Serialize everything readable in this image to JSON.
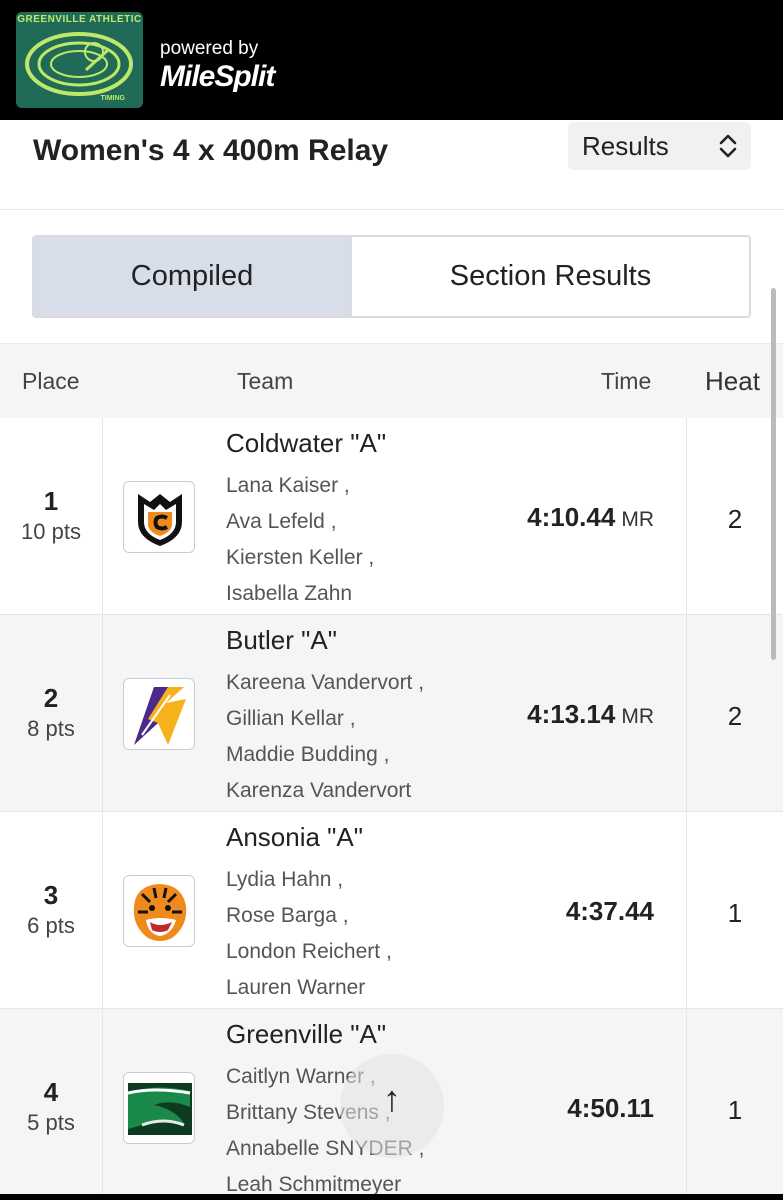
{
  "brand": {
    "logo_text": "GREENVILLE ATHLETIC",
    "logo_sub": "TIMING",
    "powered_by": "powered by",
    "wordmark": "MileSplit"
  },
  "header": {
    "event_title": "Women's 4 x 400m Relay",
    "view_select": "Results"
  },
  "tabs": {
    "compiled": "Compiled",
    "section_results": "Section Results"
  },
  "table": {
    "columns": {
      "place": "Place",
      "team": "Team",
      "time": "Time",
      "heat": "Heat"
    },
    "rows": [
      {
        "place": "1",
        "points": "10 pts",
        "team": "Coldwater \"A\"",
        "athletes": [
          "Lana Kaiser ,",
          "Ava Lefeld ,",
          "Kiersten Keller ,",
          "Isabella Zahn"
        ],
        "time": "4:10.44",
        "mark": "MR",
        "heat": "2",
        "logo": "coldwater-shield-icon"
      },
      {
        "place": "2",
        "points": "8 pts",
        "team": "Butler \"A\"",
        "athletes": [
          "Kareena Vandervort ,",
          "Gillian Kellar ,",
          "Maddie Budding ,",
          "Karenza Vandervort"
        ],
        "time": "4:13.14",
        "mark": "MR",
        "heat": "2",
        "logo": "butler-aviator-icon"
      },
      {
        "place": "3",
        "points": "6 pts",
        "team": "Ansonia \"A\"",
        "athletes": [
          "Lydia Hahn ,",
          "Rose Barga ,",
          "London Reichert ,",
          "Lauren Warner"
        ],
        "time": "4:37.44",
        "mark": "",
        "heat": "1",
        "logo": "tiger-icon"
      },
      {
        "place": "4",
        "points": "5 pts",
        "team": "Greenville \"A\"",
        "athletes": [
          "Caitlyn Warner ,",
          "Brittany Stevens ,",
          "Annabelle SNYDER ,",
          "Leah Schmitmeyer"
        ],
        "time": "4:50.11",
        "mark": "",
        "heat": "1",
        "logo": "greenwave-icon"
      }
    ]
  },
  "fab": {
    "icon": "arrow-up-icon",
    "glyph": "↑"
  },
  "colors": {
    "topbar": "#000000",
    "active_tab": "#d7deea",
    "header_row": "#f4f5f7",
    "coldwater_orange": "#f08a1c",
    "butler_purple": "#4b2a8c",
    "butler_gold": "#f6b21a",
    "greenville_green": "#1a8a4a"
  }
}
